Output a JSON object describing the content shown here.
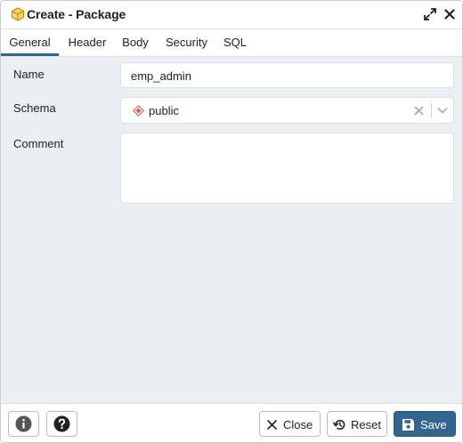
{
  "dialog": {
    "title": "Create - Package",
    "tabs": [
      "General",
      "Header",
      "Body",
      "Security",
      "SQL"
    ],
    "active_tab": "General"
  },
  "form": {
    "name_label": "Name",
    "name_value": "emp_admin",
    "schema_label": "Schema",
    "schema_value": "public",
    "comment_label": "Comment",
    "comment_value": ""
  },
  "footer": {
    "close_label": "Close",
    "reset_label": "Reset",
    "save_label": "Save"
  },
  "colors": {
    "accent": "#326690",
    "body_bg": "#ebeef3",
    "schema_icon": "#d9534f",
    "package_icon": "#e0a100"
  },
  "icons": {
    "title": "package-icon",
    "maximize": "expand-icon",
    "close": "close-icon",
    "schema": "schema-icon",
    "clear": "clear-icon",
    "dropdown": "chevron-down-icon",
    "info": "info-icon",
    "help": "help-icon",
    "close_button": "x-icon",
    "reset": "reset-icon",
    "save": "save-icon"
  }
}
